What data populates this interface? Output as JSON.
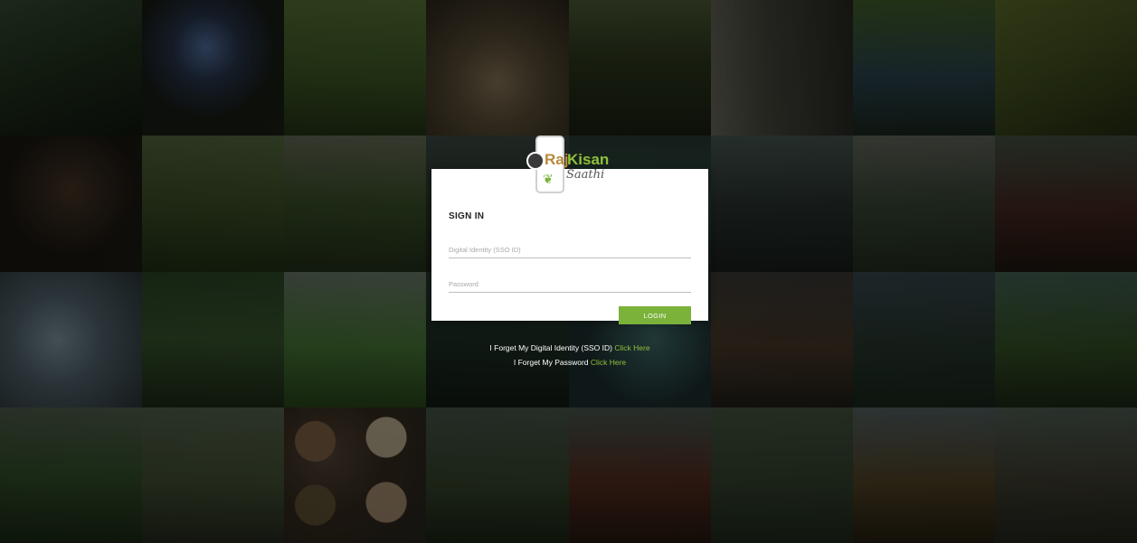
{
  "logo": {
    "brand_part1": "Raj",
    "brand_part2": "Kisan",
    "brand_subtitle": "Saathi",
    "emblem_icon": "rajasthan-emblem-icon",
    "phone_icon": "smartphone-icon",
    "sprout_icon": "sprout-icon"
  },
  "form": {
    "title": "SIGN IN",
    "sso_placeholder": "Digital Identity (SSO ID)",
    "sso_value": "",
    "password_placeholder": "Password",
    "password_value": "",
    "login_label": "LOGIN"
  },
  "help": {
    "forgot_sso_text": "I Forget My Digital Identity (SSO ID)",
    "forgot_sso_link": "Click Here",
    "forgot_password_text": "I Forget My Password",
    "forgot_password_link": "Click Here"
  },
  "colors": {
    "accent": "#7ab23a",
    "link": "#8fc03a",
    "brand_raj": "#b88a3a",
    "card_bg": "#ffffff"
  }
}
